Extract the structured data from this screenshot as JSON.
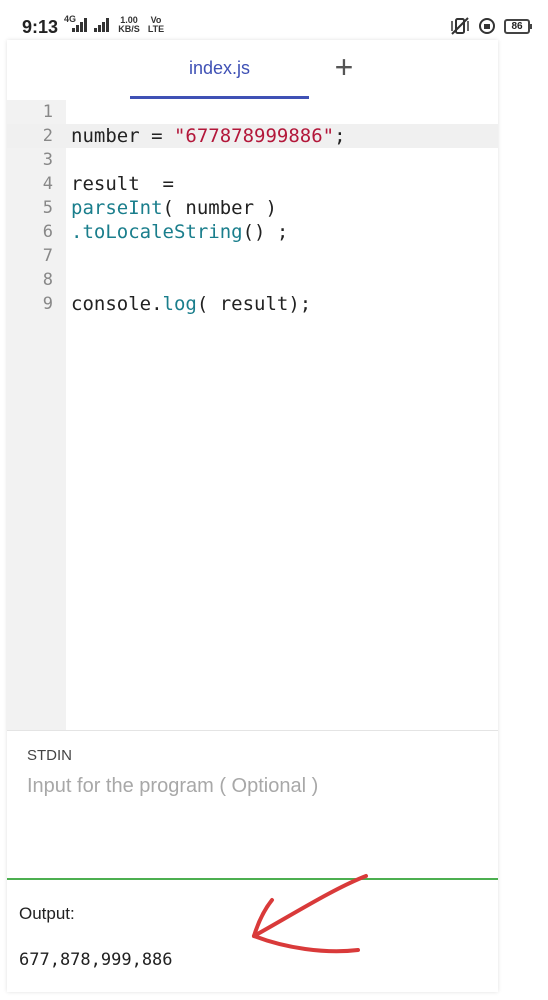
{
  "status_bar": {
    "time": "9:13",
    "network": "4G",
    "speed_value": "1.00",
    "speed_unit": "KB/S",
    "volte_top": "Vo",
    "volte_bottom": "LTE",
    "battery": "86",
    "icons": [
      "vibrate-mute-icon",
      "data-saver-icon",
      "battery-icon"
    ]
  },
  "tabs": [
    {
      "label": "index.js",
      "active": true
    }
  ],
  "add_tab_label": "+",
  "editor": {
    "lines": [
      {
        "num": "1",
        "text": ""
      },
      {
        "num": "2",
        "text": "number = \"677878999886\";",
        "active": true
      },
      {
        "num": "3",
        "text": ""
      },
      {
        "num": "4",
        "text": "result  ="
      },
      {
        "num": "5",
        "text": "parseInt( number )"
      },
      {
        "num": "6",
        "text": ".toLocaleString() ;"
      },
      {
        "num": "7",
        "text": ""
      },
      {
        "num": "8",
        "text": ""
      },
      {
        "num": "9",
        "text": "console.log( result);"
      }
    ]
  },
  "stdin": {
    "label": "STDIN",
    "placeholder": "Input for the program ( Optional )",
    "value": ""
  },
  "output": {
    "label": "Output:",
    "value": "677,878,999,886"
  },
  "colors": {
    "accent": "#3f51b5",
    "keyword": "#1a7e8c",
    "string": "#b3173a",
    "stdin_underline": "#4caf50",
    "annotation_arrow": "#d93a3a"
  }
}
